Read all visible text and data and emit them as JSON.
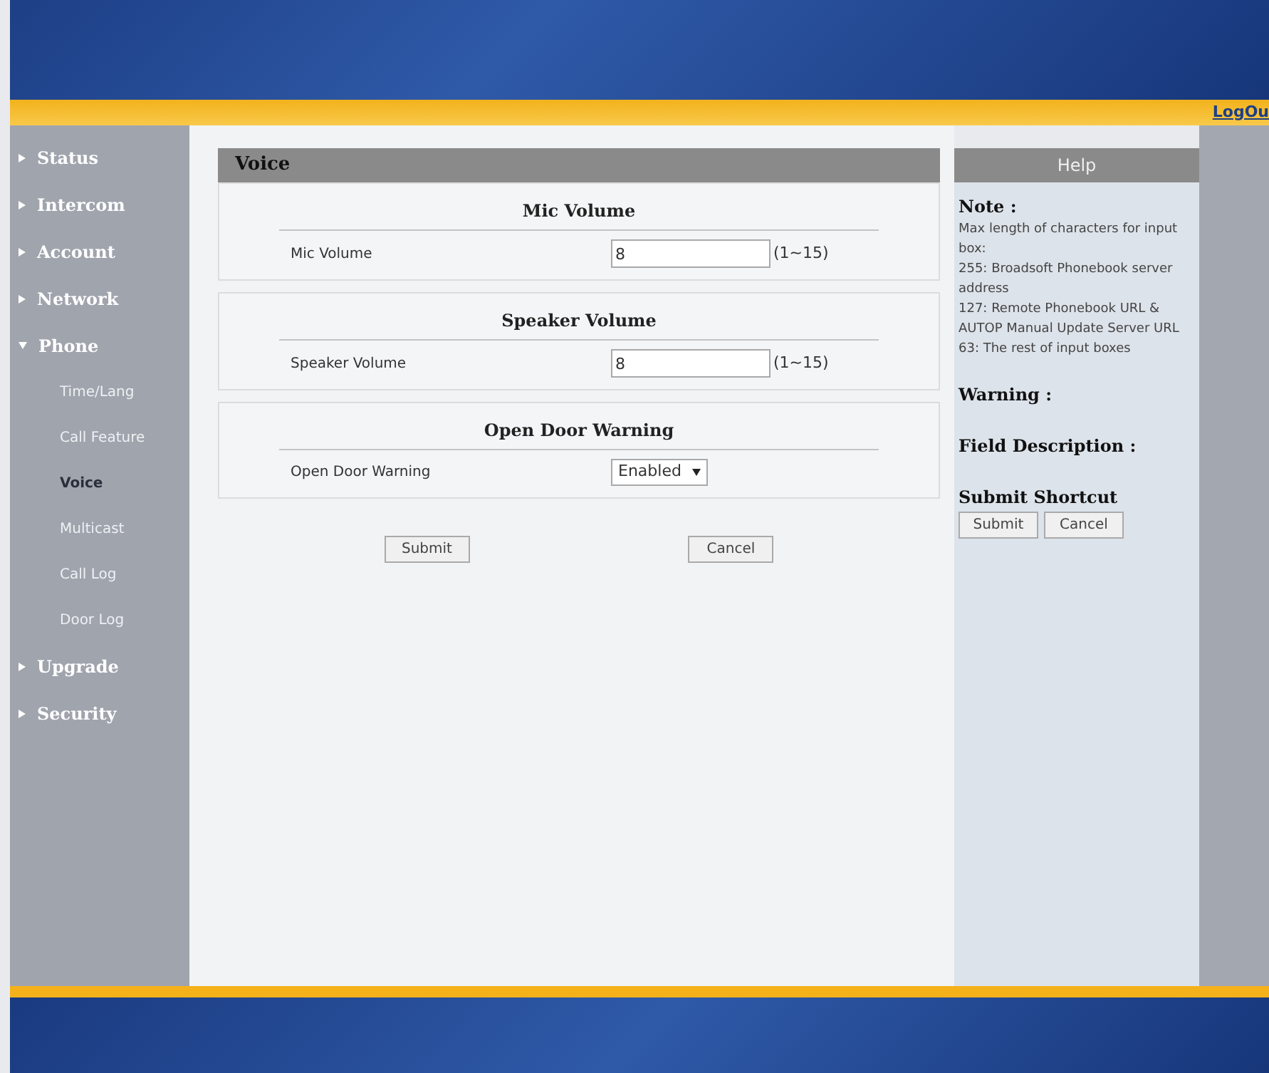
{
  "header": {
    "logout": "LogOu"
  },
  "sidebar": {
    "items": [
      {
        "label": "Status",
        "expanded": false
      },
      {
        "label": "Intercom",
        "expanded": false
      },
      {
        "label": "Account",
        "expanded": false
      },
      {
        "label": "Network",
        "expanded": false
      },
      {
        "label": "Phone",
        "expanded": true,
        "children": [
          {
            "label": "Time/Lang",
            "selected": false
          },
          {
            "label": "Call Feature",
            "selected": false
          },
          {
            "label": "Voice",
            "selected": true
          },
          {
            "label": "Multicast",
            "selected": false
          },
          {
            "label": "Call Log",
            "selected": false
          },
          {
            "label": "Door Log",
            "selected": false
          }
        ]
      },
      {
        "label": "Upgrade",
        "expanded": false
      },
      {
        "label": "Security",
        "expanded": false
      }
    ]
  },
  "page": {
    "title": "Voice",
    "sections": [
      {
        "title": "Mic Volume",
        "field": {
          "kind": "input",
          "label": "Mic Volume",
          "value": "8",
          "hint": "(1~15)"
        }
      },
      {
        "title": "Speaker Volume",
        "field": {
          "kind": "input",
          "label": "Speaker Volume",
          "value": "8",
          "hint": "(1~15)"
        }
      },
      {
        "title": "Open Door Warning",
        "field": {
          "kind": "select",
          "label": "Open Door Warning",
          "value": "Enabled"
        }
      }
    ],
    "buttons": [
      "Submit",
      "Cancel"
    ]
  },
  "help": {
    "title": "Help",
    "note_heading": "Note :",
    "note_lines": [
      "Max length of characters for input box:",
      "255: Broadsoft Phonebook server address",
      "127: Remote Phonebook URL & AUTOP Manual Update Server URL",
      "63: The rest of input boxes"
    ],
    "warning_heading": "Warning :",
    "field_description_heading": "Field Description :",
    "shortcut_heading": "Submit Shortcut",
    "buttons": [
      "Submit",
      "Cancel"
    ]
  }
}
